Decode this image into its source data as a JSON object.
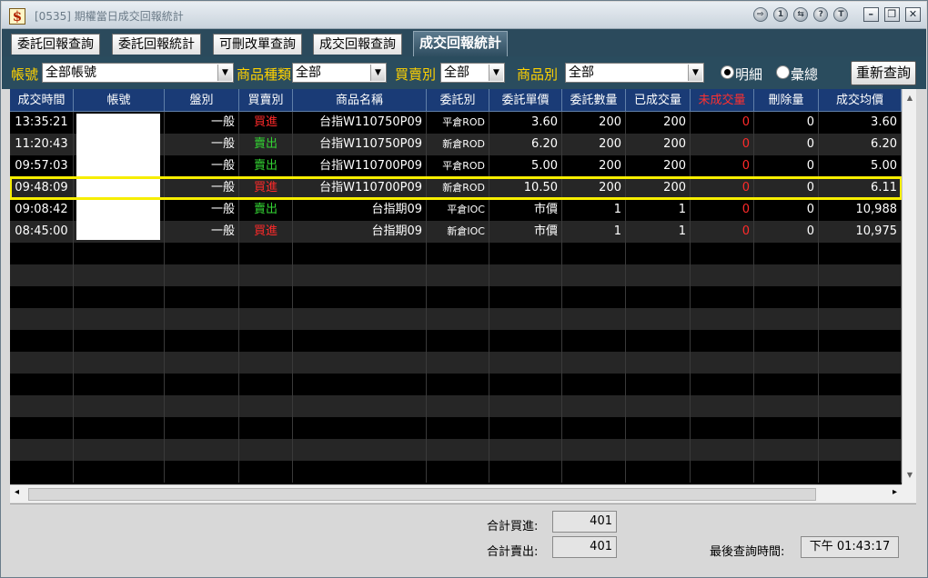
{
  "window": {
    "app_icon": "$",
    "title": "[0535] 期權當日成交回報統計",
    "title_buttons": [
      "⇨",
      "1",
      "⇆",
      "?",
      "T"
    ],
    "window_buttons": [
      "–",
      "❐",
      "✕"
    ]
  },
  "tabs": [
    {
      "label": "委託回報查詢",
      "active": false
    },
    {
      "label": "委託回報統計",
      "active": false
    },
    {
      "label": "可刪改單查詢",
      "active": false
    },
    {
      "label": "成交回報查詢",
      "active": false
    },
    {
      "label": "成交回報統計",
      "active": true
    }
  ],
  "filters": {
    "account_label": "帳號",
    "account_value": "全部帳號",
    "product_type_label": "商品種類",
    "product_type_value": "全部",
    "side_label": "買賣別",
    "side_value": "全部",
    "product_label": "商品別",
    "product_value": "全部",
    "radio_detail": "明細",
    "radio_summary": "彙總",
    "radio_selected": "detail",
    "query_button": "重新查詢"
  },
  "table": {
    "columns": [
      "成交時間",
      "帳號",
      "盤別",
      "買賣別",
      "商品名稱",
      "委託別",
      "委託單價",
      "委託數量",
      "已成交量",
      "未成交量",
      "刪除量",
      "成交均價"
    ],
    "rows": [
      {
        "time": "13:35:21",
        "account": "",
        "session": "一般",
        "side": "買進",
        "product": "台指W110750P09",
        "order_type": "平倉ROD",
        "price": "3.60",
        "qty": "200",
        "filled": "200",
        "unfilled": "0",
        "cancelled": "0",
        "avg": "3.60"
      },
      {
        "time": "11:20:43",
        "account": "",
        "session": "一般",
        "side": "賣出",
        "product": "台指W110750P09",
        "order_type": "新倉ROD",
        "price": "6.20",
        "qty": "200",
        "filled": "200",
        "unfilled": "0",
        "cancelled": "0",
        "avg": "6.20"
      },
      {
        "time": "09:57:03",
        "account": "",
        "session": "一般",
        "side": "賣出",
        "product": "台指W110700P09",
        "order_type": "平倉ROD",
        "price": "5.00",
        "qty": "200",
        "filled": "200",
        "unfilled": "0",
        "cancelled": "0",
        "avg": "5.00"
      },
      {
        "time": "09:48:09",
        "account": "",
        "session": "一般",
        "side": "買進",
        "product": "台指W110700P09",
        "order_type": "新倉ROD",
        "price": "10.50",
        "qty": "200",
        "filled": "200",
        "unfilled": "0",
        "cancelled": "0",
        "avg": "6.11"
      },
      {
        "time": "09:08:42",
        "account": "",
        "session": "一般",
        "side": "賣出",
        "product": "台指期09",
        "order_type": "平倉IOC",
        "price": "市價",
        "qty": "1",
        "filled": "1",
        "unfilled": "0",
        "cancelled": "0",
        "avg": "10,988"
      },
      {
        "time": "08:45:00",
        "account": "",
        "session": "一般",
        "side": "買進",
        "product": "台指期09",
        "order_type": "新倉IOC",
        "price": "市價",
        "qty": "1",
        "filled": "1",
        "unfilled": "0",
        "cancelled": "0",
        "avg": "10,975"
      }
    ],
    "highlighted_row": 3
  },
  "footer": {
    "buy_total_label": "合計買進:",
    "buy_total": "401",
    "sell_total_label": "合計賣出:",
    "sell_total": "401",
    "last_query_label": "最後查詢時間:",
    "last_query_time": "下午 01:43:17"
  },
  "colors": {
    "buy": "#ff2a2a",
    "sell": "#33d433",
    "highlight": "#f7ee00",
    "header_bg": "#1a3b76",
    "filter_label": "#ffd200"
  }
}
